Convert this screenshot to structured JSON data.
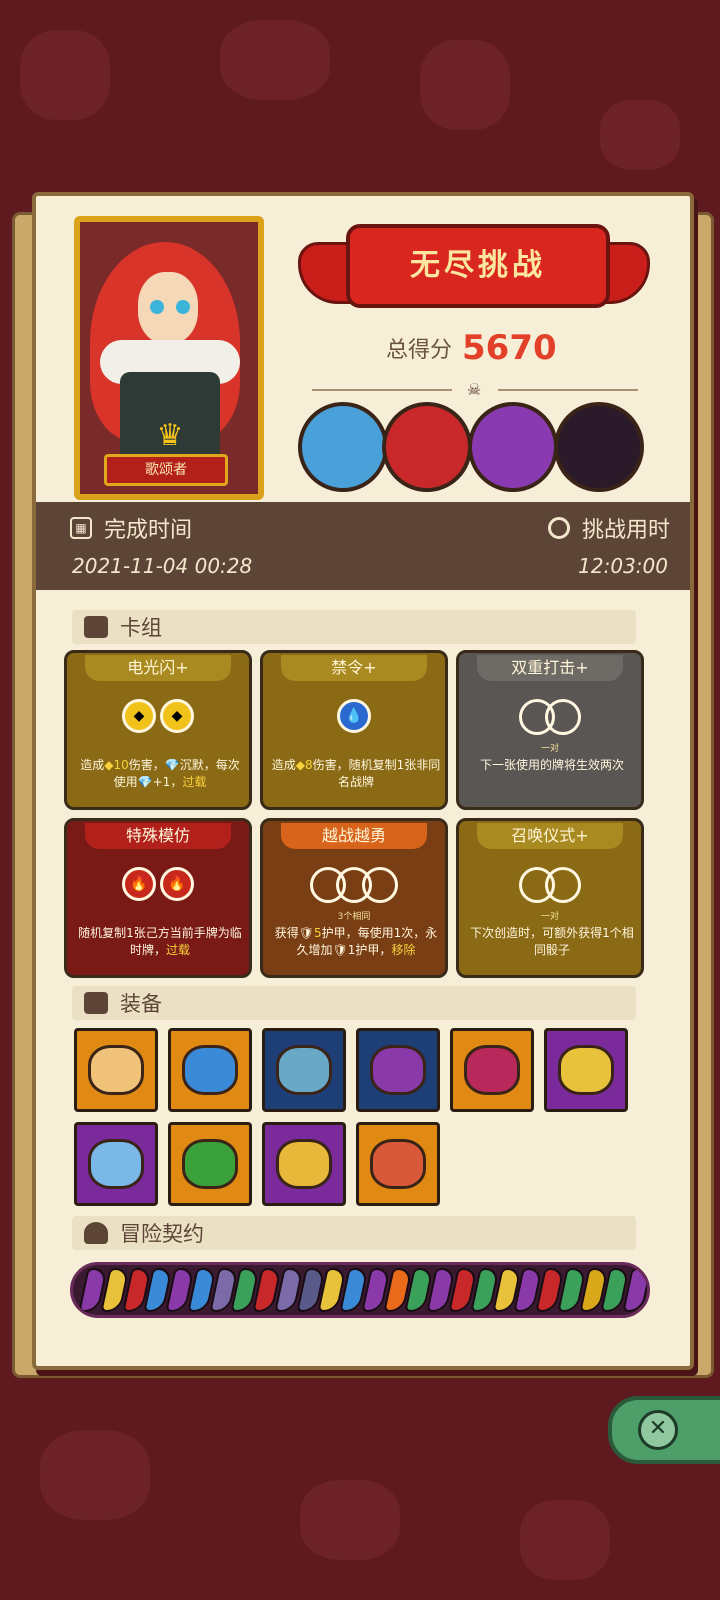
{
  "colors": {
    "background": "#5e1a1e",
    "page": "#f7eed8",
    "accent_red": "#e3402a",
    "band": "#5c4536"
  },
  "hero": {
    "name": "歌颂者",
    "badge_icon": "crown-icon"
  },
  "challenge": {
    "title": "无尽挑战",
    "score_label": "总得分",
    "score_value": "5670"
  },
  "bosses": [
    {
      "name": "mushroom-elder",
      "color": "#4aa0d8"
    },
    {
      "name": "cage-warrior",
      "color": "#c8282a"
    },
    {
      "name": "shadow-beast",
      "color": "#8a3ab0"
    },
    {
      "name": "vampire",
      "color": "#2a1a2a"
    }
  ],
  "times": {
    "finish_label": "完成时间",
    "finish_value": "2021-11-04 00:28",
    "duration_label": "挑战用时",
    "duration_value": "12:03:00"
  },
  "sections": {
    "deck": "卡组",
    "equipment": "装备",
    "contract": "冒险契约"
  },
  "cards": [
    {
      "title": "电光闪+",
      "bg": "#8a6a14",
      "title_bg": "#a88a20",
      "orbs": [
        "◆",
        "◆"
      ],
      "orb_bg": "#f0c21a",
      "note": "",
      "desc_parts": [
        "造成",
        "◆",
        "10",
        "伤害，",
        "💎",
        "沉默，每次使用",
        "💎",
        "+1，",
        "过载"
      ]
    },
    {
      "title": "禁令+",
      "bg": "#8a6a14",
      "title_bg": "#a88a20",
      "orbs": [
        "💧"
      ],
      "orb_bg": "#2a6ad0",
      "note": "",
      "desc_parts": [
        "造成",
        "◆",
        "8",
        "伤害，随机复制1张非同名战牌"
      ]
    },
    {
      "title": "双重打击+",
      "bg": "#5a5654",
      "title_bg": "#6e6a66",
      "orbs": [
        "",
        ""
      ],
      "orb_bg": "",
      "note": "一对",
      "desc_parts": [
        "下一张使用的牌将生效两次"
      ]
    },
    {
      "title": "特殊模仿",
      "bg": "#7a1a16",
      "title_bg": "#b2201c",
      "orbs": [
        "🔥",
        "🔥"
      ],
      "orb_bg": "#c8281c",
      "note": "",
      "desc_parts": [
        "随机复制1张己方当前手牌为临时牌，",
        "过载"
      ]
    },
    {
      "title": "越战越勇",
      "bg": "#7a3e14",
      "title_bg": "#d8641c",
      "orbs": [
        "",
        "",
        ""
      ],
      "orb_bg": "",
      "note": "3个相同",
      "desc_parts": [
        "获得",
        "🛡",
        "5",
        "护甲，每使用1次，永久增加",
        "🛡",
        "1护甲，",
        "移除"
      ]
    },
    {
      "title": "召唤仪式+",
      "bg": "#8a6a14",
      "title_bg": "#a88a20",
      "orbs": [
        "",
        ""
      ],
      "orb_bg": "",
      "note": "一对",
      "desc_parts": [
        "下次创造时，可额外获得1个相同骰子"
      ]
    }
  ],
  "equipment": [
    {
      "name": "shield-coin",
      "bg": "#e08a14",
      "art": "#f0c27a"
    },
    {
      "name": "blue-slime",
      "bg": "#e08a14",
      "art": "#3a8ad8"
    },
    {
      "name": "leaf-ring",
      "bg": "#1e3e78",
      "art": "#6aa8c8"
    },
    {
      "name": "skull-tome",
      "bg": "#1e3e78",
      "art": "#8a3aa8"
    },
    {
      "name": "cursed-heart",
      "bg": "#e08a14",
      "art": "#b8285a"
    },
    {
      "name": "sun-amulet",
      "bg": "#7a2a9a",
      "art": "#e8c23a"
    },
    {
      "name": "ice-dagger",
      "bg": "#7a2a9a",
      "art": "#7ab8e8"
    },
    {
      "name": "green-tablet",
      "bg": "#e08a14",
      "art": "#3aa03a"
    },
    {
      "name": "ruby-ring",
      "bg": "#7a2a9a",
      "art": "#e8b83a"
    },
    {
      "name": "meat-leg",
      "bg": "#e08a14",
      "art": "#d8583a"
    }
  ],
  "contracts": [
    "#8a3aa8",
    "#e8c23a",
    "#c8282a",
    "#3a8ad8",
    "#8a3aa8",
    "#3a8ad8",
    "#7a6aa8",
    "#3aa05a",
    "#c8282a",
    "#7a6aa8",
    "#5a5a8a",
    "#e8c23a",
    "#3a8ad8",
    "#8a3aa8",
    "#e86a1a",
    "#3aa05a",
    "#8a3aa8",
    "#c8282a",
    "#3aa05a",
    "#e8c23a",
    "#8a3aa8",
    "#c8282a",
    "#3aa05a",
    "#d8a81a",
    "#3aa05a",
    "#8a3aa8"
  ]
}
